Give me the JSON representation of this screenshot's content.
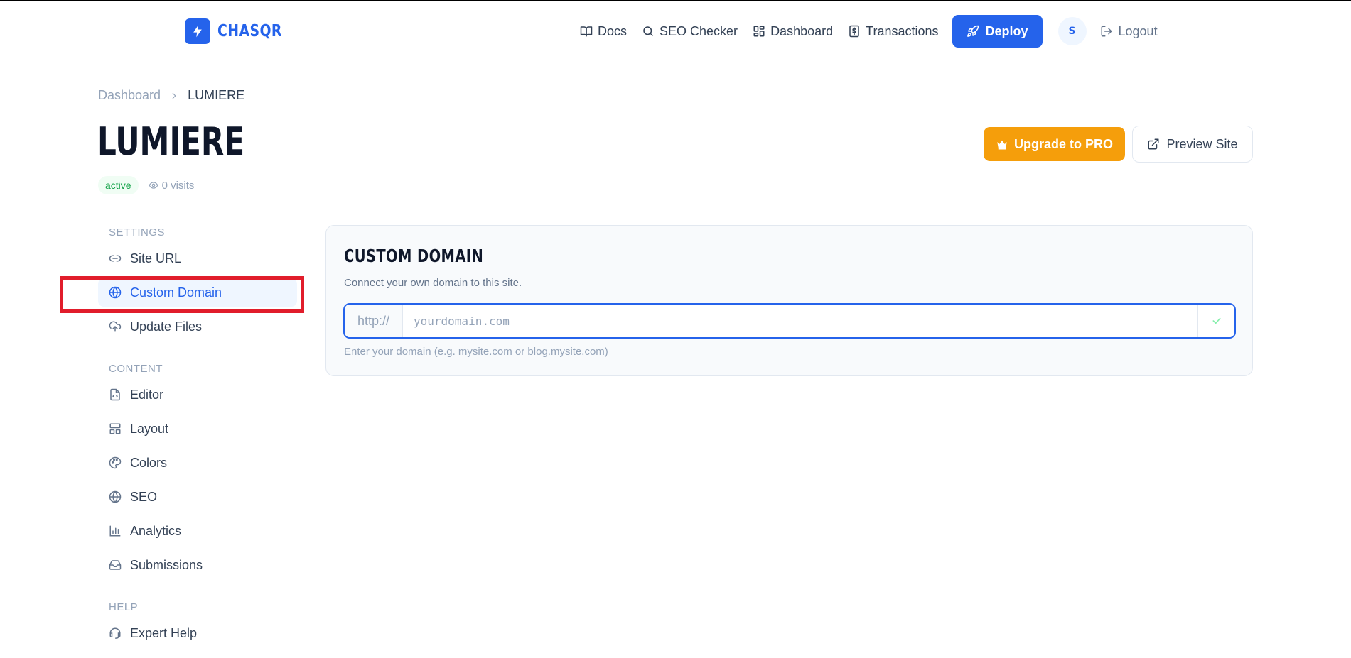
{
  "brand": {
    "name": "CHASQR",
    "accent": "#2563eb"
  },
  "nav": {
    "docs": "Docs",
    "seo_checker": "SEO Checker",
    "dashboard": "Dashboard",
    "transactions": "Transactions",
    "deploy": "Deploy",
    "avatar_initial": "S",
    "logout": "Logout"
  },
  "breadcrumb": {
    "parent": "Dashboard",
    "current": "LUMIERE"
  },
  "site": {
    "title": "LUMIERE",
    "status": "active",
    "visits": "0 visits"
  },
  "actions": {
    "upgrade": "Upgrade to PRO",
    "preview": "Preview Site"
  },
  "sidebar": {
    "sections": [
      {
        "title": "SETTINGS",
        "items": [
          {
            "label": "Site URL",
            "icon": "link-icon"
          },
          {
            "label": "Custom Domain",
            "icon": "globe-icon",
            "active": true
          },
          {
            "label": "Update Files",
            "icon": "cloud-upload-icon"
          }
        ]
      },
      {
        "title": "CONTENT",
        "items": [
          {
            "label": "Editor",
            "icon": "file-code-icon"
          },
          {
            "label": "Layout",
            "icon": "layout-icon"
          },
          {
            "label": "Colors",
            "icon": "palette-icon"
          },
          {
            "label": "SEO",
            "icon": "globe-icon"
          },
          {
            "label": "Analytics",
            "icon": "bar-chart-icon"
          },
          {
            "label": "Submissions",
            "icon": "inbox-icon"
          }
        ]
      },
      {
        "title": "HELP",
        "items": [
          {
            "label": "Expert Help",
            "icon": "headset-icon"
          }
        ]
      }
    ]
  },
  "custom_domain": {
    "title": "CUSTOM DOMAIN",
    "description": "Connect your own domain to this site.",
    "prefix": "http://",
    "placeholder": "yourdomain.com",
    "value": "",
    "help": "Enter your domain (e.g. mysite.com or blog.mysite.com)"
  },
  "colors": {
    "primary": "#2563eb",
    "upgrade": "#f59e0b",
    "active_badge": "#16a34a",
    "highlight": "#e11d2b"
  }
}
